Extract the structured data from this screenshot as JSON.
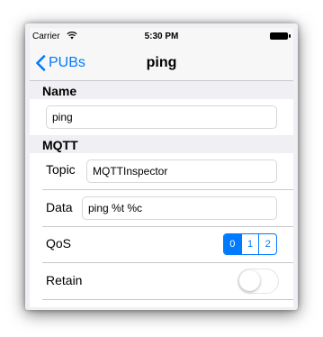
{
  "status_bar": {
    "carrier": "Carrier",
    "wifi_icon": "wifi-icon",
    "time": "5:30 PM",
    "battery_icon": "battery-icon"
  },
  "nav": {
    "back_label": "PUBs",
    "back_icon": "chevron-left-icon",
    "title": "ping"
  },
  "name_section": {
    "header": "Name",
    "value": "ping"
  },
  "mqtt_section": {
    "header": "MQTT",
    "topic_label": "Topic",
    "topic_value": "MQTTInspector",
    "data_label": "Data",
    "data_value": "ping %t %c",
    "qos_label": "QoS",
    "qos_options": [
      "0",
      "1",
      "2"
    ],
    "qos_selected": "0",
    "retain_label": "Retain",
    "retain_on": false
  },
  "colors": {
    "accent": "#007aff",
    "background": "#efeff4",
    "separator": "#c8c7cc"
  }
}
